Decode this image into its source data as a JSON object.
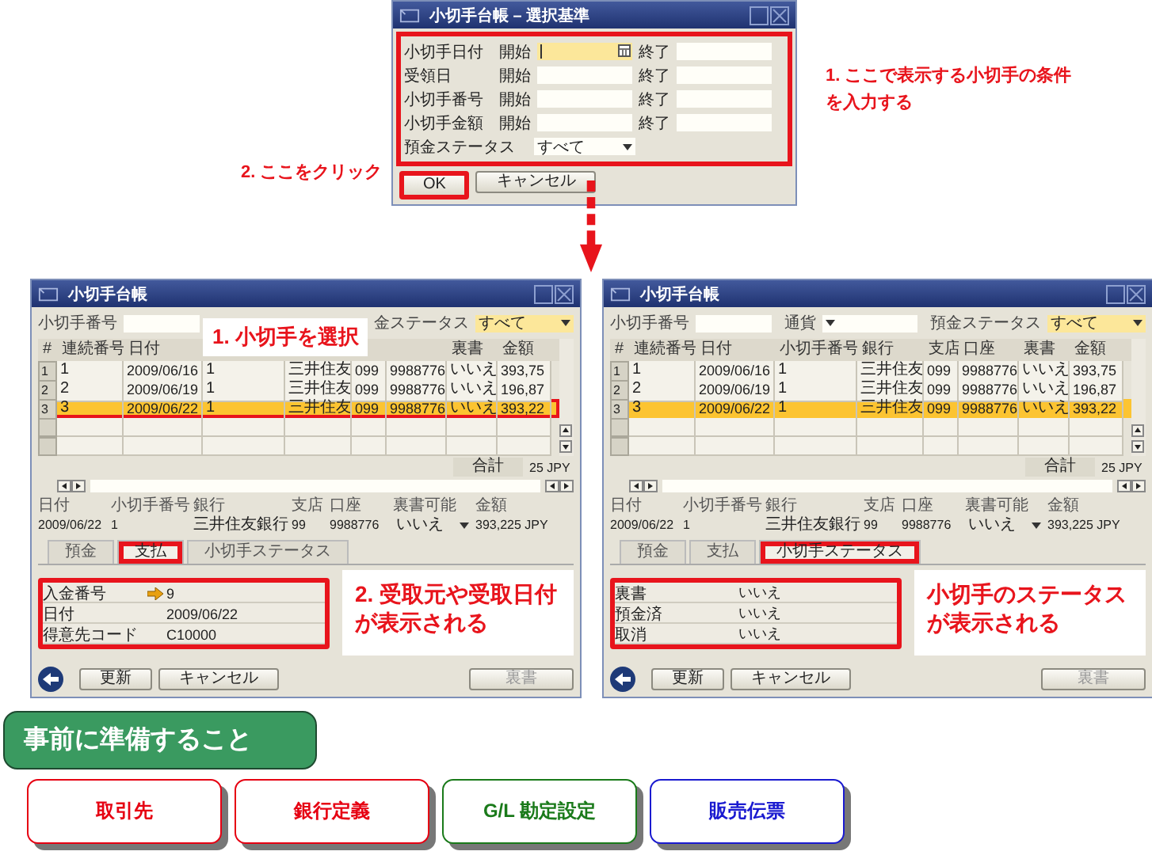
{
  "criteria_dialog": {
    "title": "小切手台帳 – 選択基準",
    "marked": true,
    "rows": [
      {
        "label": "小切手日付",
        "from": "開始",
        "to": "終了",
        "focused": true
      },
      {
        "label": "受領日",
        "from": "開始",
        "to": "終了",
        "focused": false
      },
      {
        "label": "小切手番号",
        "from": "開始",
        "to": "終了",
        "focused": false
      },
      {
        "label": "小切手金額",
        "from": "開始",
        "to": "終了",
        "focused": false
      }
    ],
    "status_label": "預金ステータス",
    "status_value": "すべて",
    "buttons": [
      {
        "label": "OK",
        "marked": true
      },
      {
        "label": "キャンセル",
        "marked": false
      }
    ]
  },
  "notes": [
    "1. ここで表示する小切手の条件を入力する",
    "2. ここをクリック"
  ],
  "windows": [
    {
      "title": "小切手台帳",
      "header_note": "1. 小切手を選択",
      "filters": [
        {
          "kind": "text",
          "label": "小切手番号"
        },
        {
          "kind": "select",
          "label": "金ステータス",
          "value": "すべて",
          "highlighted": true
        }
      ],
      "columns": [
        {
          "label": "#"
        },
        {
          "label": "連続番号"
        },
        {
          "label": "日付"
        },
        {},
        {},
        {},
        {},
        {
          "label": "裏書"
        },
        {
          "label": "金額"
        }
      ],
      "rows": [
        {
          "cells": [
            "1",
            "1",
            "2009/06/16",
            "1",
            "三井住友",
            "099",
            "9988776",
            "いいえ",
            "393,75"
          ],
          "selected": false,
          "marked": false
        },
        {
          "cells": [
            "2",
            "2",
            "2009/06/19",
            "1",
            "三井住友",
            "099",
            "9988776",
            "いいえ",
            "196,87"
          ],
          "selected": false,
          "marked": false
        },
        {
          "cells": [
            "3",
            "3",
            "2009/06/22",
            "1",
            "三井住友",
            "099",
            "9988776",
            "いいえ",
            "393,22"
          ],
          "selected": true,
          "marked": true
        }
      ],
      "total_label": "合計",
      "total_value": "25 JPY",
      "detail": [
        {
          "label": "日付",
          "value": "2009/06/22"
        },
        {
          "label": "小切手番号",
          "value": "1"
        },
        {
          "label": "銀行",
          "value": "三井住友銀行"
        },
        {
          "label": "支店",
          "value": "99"
        },
        {
          "label": "口座",
          "value": "9988776"
        },
        {
          "label": "裏書可能",
          "value": "いいえ",
          "kind": "select"
        },
        {
          "label": "金額",
          "value": "393,225 JPY"
        }
      ],
      "tabs": [
        {
          "label": "預金",
          "selected": false,
          "marked": false
        },
        {
          "label": "支払",
          "selected": true,
          "marked": true
        },
        {
          "label": "小切手ステータス",
          "selected": false,
          "marked": false
        }
      ],
      "panel_marked": true,
      "panel_rows": [
        {
          "label": "入金番号",
          "value": "9",
          "link": true
        },
        {
          "label": "日付",
          "value": "2009/06/22",
          "link": false
        },
        {
          "label": "得意先コード",
          "value": "C10000",
          "link": false
        }
      ],
      "panel_note": "2. 受取元や受取日付が表示される",
      "buttons": [
        {
          "label": "更新",
          "disabled": false
        },
        {
          "label": "キャンセル",
          "disabled": false
        },
        {
          "label": "裏書",
          "disabled": true
        }
      ]
    },
    {
      "title": "小切手台帳",
      "filters": [
        {
          "kind": "text",
          "label": "小切手番号"
        },
        {
          "kind": "select",
          "label": "通貨",
          "highlighted": false
        },
        {
          "kind": "select",
          "label": "預金ステータス",
          "value": "すべて",
          "highlighted": true
        }
      ],
      "columns": [
        {
          "label": "#"
        },
        {
          "label": "連続番号"
        },
        {
          "label": "日付"
        },
        {
          "label": "小切手番号"
        },
        {
          "label": "銀行"
        },
        {
          "label": "支店"
        },
        {
          "label": "口座"
        },
        {
          "label": "裏書"
        },
        {
          "label": "金額"
        }
      ],
      "rows": [
        {
          "cells": [
            "1",
            "1",
            "2009/06/16",
            "1",
            "三井住友",
            "099",
            "9988776",
            "いいえ",
            "393,75"
          ],
          "selected": false,
          "marked": false
        },
        {
          "cells": [
            "2",
            "2",
            "2009/06/19",
            "1",
            "三井住友",
            "099",
            "9988776",
            "いいえ",
            "196,87"
          ],
          "selected": false,
          "marked": false
        },
        {
          "cells": [
            "3",
            "3",
            "2009/06/22",
            "1",
            "三井住友",
            "099",
            "9988776",
            "いいえ",
            "393,22"
          ],
          "selected": true,
          "marked": false
        }
      ],
      "total_label": "合計",
      "total_value": "25 JPY",
      "detail": [
        {
          "label": "日付",
          "value": "2009/06/22"
        },
        {
          "label": "小切手番号",
          "value": "1"
        },
        {
          "label": "銀行",
          "value": "三井住友銀行"
        },
        {
          "label": "支店",
          "value": "99"
        },
        {
          "label": "口座",
          "value": "9988776"
        },
        {
          "label": "裏書可能",
          "value": "いいえ",
          "kind": "select"
        },
        {
          "label": "金額",
          "value": "393,225 JPY"
        }
      ],
      "tabs": [
        {
          "label": "預金",
          "selected": false,
          "marked": false
        },
        {
          "label": "支払",
          "selected": false,
          "marked": false
        },
        {
          "label": "小切手ステータス",
          "selected": true,
          "marked": true
        }
      ],
      "panel_marked": true,
      "panel_rows": [
        {
          "label": "裏書",
          "value": "いいえ",
          "link": false
        },
        {
          "label": "預金済",
          "value": "いいえ",
          "link": false
        },
        {
          "label": "取消",
          "value": "いいえ",
          "link": false
        }
      ],
      "panel_note": "小切手のステータスが表示される",
      "buttons": [
        {
          "label": "更新",
          "disabled": false
        },
        {
          "label": "キャンセル",
          "disabled": false
        },
        {
          "label": "裏書",
          "disabled": true
        }
      ]
    }
  ],
  "prep": {
    "title": "事前に準備すること",
    "items": [
      {
        "label": "取引先",
        "color": "#e60012"
      },
      {
        "label": "銀行定義",
        "color": "#e60012"
      },
      {
        "label": "G/L 勘定設定",
        "color": "#1a7a1a"
      },
      {
        "label": "販売伝票",
        "color": "#1a1ad0"
      }
    ]
  }
}
